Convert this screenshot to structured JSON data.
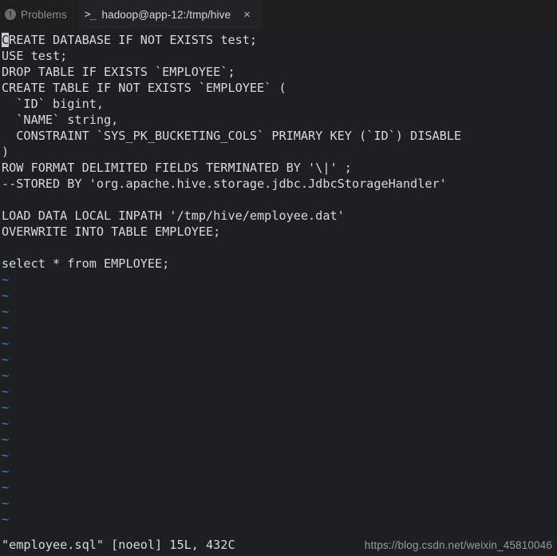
{
  "panel": {
    "tabs": [
      {
        "id": "problems",
        "label": "Problems",
        "icon": "warning-circle-icon",
        "icon_glyph": "!",
        "active": false
      },
      {
        "id": "terminal",
        "label": "hadoop@app-12:/tmp/hive",
        "icon": "terminal-prompt-icon",
        "icon_glyph": ">_",
        "active": true,
        "close_glyph": "×"
      }
    ]
  },
  "editor": {
    "program": "vim",
    "file": "employee.sql",
    "cursor_char": "C",
    "lines": [
      "REATE DATABASE IF NOT EXISTS test;",
      "USE test;",
      "DROP TABLE IF EXISTS `EMPLOYEE`;",
      "CREATE TABLE IF NOT EXISTS `EMPLOYEE` (",
      "  `ID` bigint,",
      "  `NAME` string,",
      "  CONSTRAINT `SYS_PK_BUCKETING_COLS` PRIMARY KEY (`ID`) DISABLE",
      ")",
      "ROW FORMAT DELIMITED FIELDS TERMINATED BY '\\|' ;",
      "--STORED BY 'org.apache.hive.storage.jdbc.JdbcStorageHandler'",
      "",
      "LOAD DATA LOCAL INPATH '/tmp/hive/employee.dat'",
      "OVERWRITE INTO TABLE EMPLOYEE;",
      "",
      "select * from EMPLOYEE;"
    ],
    "empty_marker": "~",
    "empty_marker_count": 16
  },
  "status": {
    "text": "\"employee.sql\" [noeol] 15L, 432C"
  },
  "watermark": {
    "text": "https://blog.csdn.net/weixin_45810046"
  },
  "colors": {
    "background": "#1d1f21",
    "panel_background": "#1e1e1e",
    "text": "#d6dae0",
    "tilde": "#4f7fd4",
    "tab_inactive": "#8d8d8d",
    "tab_active": "#d7d7d7",
    "cursor": "#c9cbcd",
    "watermark": "#9a9a9a"
  }
}
